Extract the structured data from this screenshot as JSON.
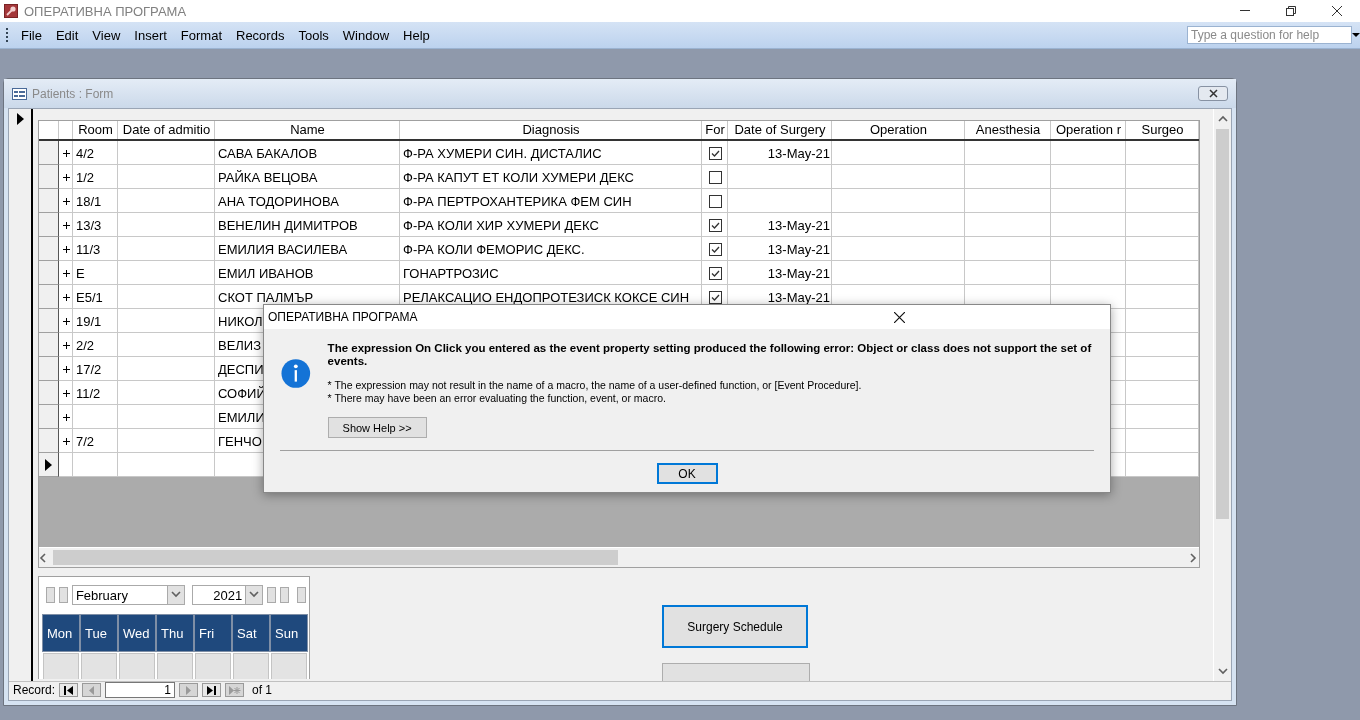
{
  "window": {
    "title": "ОПЕРАТИВНА ПРОГРАМА"
  },
  "menu": [
    "File",
    "Edit",
    "View",
    "Insert",
    "Format",
    "Records",
    "Tools",
    "Window",
    "Help"
  ],
  "help_search": {
    "placeholder": "Type a question for help"
  },
  "form": {
    "title": "Patients : Form",
    "table": {
      "columns": [
        "Room",
        "Date of admitio",
        "Name",
        "Diagnosis",
        "For",
        "Date of Surgery",
        "Operation",
        "Anesthesia",
        "Operation r",
        "Surgeo"
      ],
      "rows": [
        {
          "room": "4/2",
          "name": "САВА БАКАЛОВ",
          "diagnosis": "Ф-РА ХУМЕРИ СИН. ДИСТАЛИС",
          "checked": true,
          "date_of_surgery": "13-May-21"
        },
        {
          "room": "1/2",
          "name": "РАЙКА ВЕЦОВА",
          "diagnosis": "Ф-РА КАПУТ ЕТ КОЛИ ХУМЕРИ ДЕКС",
          "checked": false
        },
        {
          "room": "18/1",
          "name": "АНА ТОДОРИНОВА",
          "diagnosis": "Ф-РА ПЕРТРОХАНТЕРИКА ФЕМ СИН",
          "checked": false
        },
        {
          "room": "13/3",
          "name": "ВЕНЕЛИН ДИМИТРОВ",
          "diagnosis": "Ф-РА КОЛИ ХИР ХУМЕРИ ДЕКС",
          "checked": true,
          "date_of_surgery": "13-May-21"
        },
        {
          "room": "11/3",
          "name": "ЕМИЛИЯ ВАСИЛЕВА",
          "diagnosis": "Ф-РА КОЛИ ФЕМОРИС ДЕКС.",
          "checked": true,
          "date_of_surgery": "13-May-21"
        },
        {
          "room": "E",
          "name": "ЕМИЛ ИВАНОВ",
          "diagnosis": "ГОНАРТРОЗИС",
          "checked": true,
          "date_of_surgery": "13-May-21"
        },
        {
          "room": "E5/1",
          "name": "СКОТ ПАЛМЪР",
          "diagnosis": "РЕЛАКСАЦИО ЕНДОПРОТЕЗИСК КОКСЕ СИН",
          "checked": true,
          "date_of_surgery": "13-May-21"
        },
        {
          "room": "19/1",
          "name": "НИКОЛ"
        },
        {
          "room": "2/2",
          "name": "ВЕЛИЗ"
        },
        {
          "room": "17/2",
          "name": "ДЕСПИ"
        },
        {
          "room": "11/2",
          "name": "СОФИЙ"
        },
        {
          "name": "ЕМИЛИ"
        },
        {
          "room": "7/2",
          "name": "ГЕНЧО"
        }
      ]
    },
    "calendar": {
      "month": "February",
      "year": "2021",
      "weekdays": [
        "Mon",
        "Tue",
        "Wed",
        "Thu",
        "Fri",
        "Sat",
        "Sun"
      ]
    },
    "schedule_button": {
      "label": "Surgery Schedule",
      "focused": true
    },
    "record_nav": {
      "label": "Record:",
      "current": "1",
      "total": "of 1",
      "buttons": [
        {
          "kind": "first",
          "disabled": false
        },
        {
          "kind": "prev",
          "disabled": true
        },
        {
          "kind": "next",
          "disabled": true
        },
        {
          "kind": "last",
          "disabled": false
        },
        {
          "kind": "new",
          "disabled": true
        }
      ]
    }
  },
  "dialog": {
    "title": "ОПЕРАТИВНА ПРОГРАМА",
    "message": "The expression On Click you entered as the event property setting produced the following error: Object or class does not support the set of events.",
    "notes": [
      "* The expression may not result in the name of a macro, the name of a user-defined function, or [Event Procedure].",
      "* There may have been an error evaluating the function, event, or macro."
    ],
    "help_button": "Show Help >>",
    "ok_button": "OK"
  }
}
